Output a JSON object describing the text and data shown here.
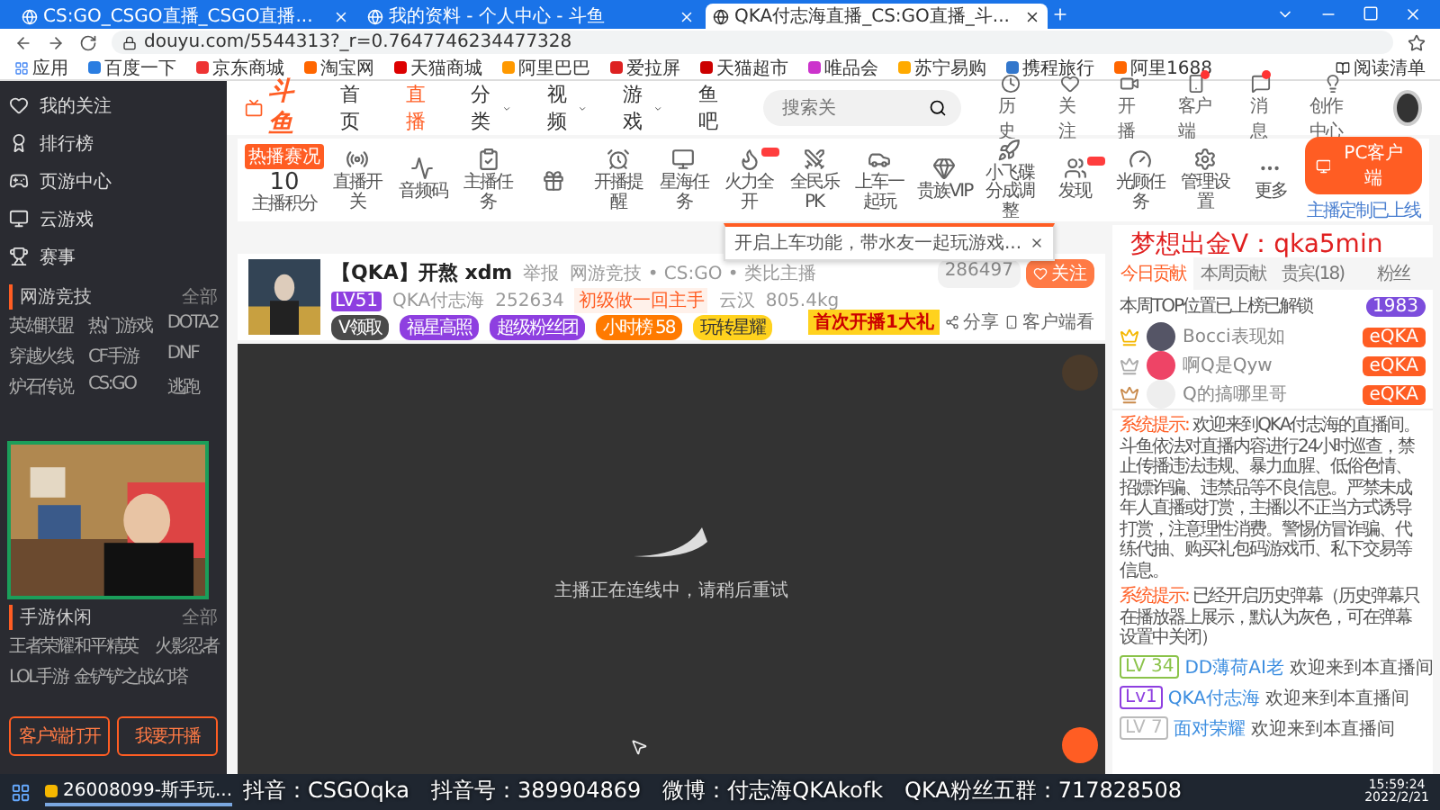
{
  "browser": {
    "tabs": [
      {
        "title": "CS:GO_CSGO直播_CSGO直播...",
        "selected": false
      },
      {
        "title": "我的资料 - 个人中心 - 斗鱼",
        "selected": false
      },
      {
        "title": "QKA付志海直播_CS:GO直播_斗...",
        "selected": true
      }
    ],
    "url": "douyu.com/5544313?_r=0.7647746234477328",
    "bookmarks": [
      "应用",
      "百度一下",
      "京东商城",
      "淘宝网",
      "天猫商城",
      "阿里巴巴",
      "爱拉屏",
      "天猫超市",
      "唯品会",
      "苏宁易购",
      "携程旅行",
      "阿里1688"
    ],
    "reading_list": "阅读清单"
  },
  "sidebar": {
    "items": [
      "我的关注",
      "排行榜",
      "页游中心",
      "云游戏",
      "赛事"
    ],
    "sections": [
      {
        "title": "网游竞技",
        "more": "全部",
        "games": [
          "英雄联盟",
          "热门游戏",
          "DOTA2",
          "穿越火线",
          "CF手游",
          "DNF",
          "炉石传说",
          "CS:GO",
          "逃跑"
        ]
      },
      {
        "title": "手游休闲",
        "more": "全部",
        "games": [
          "王者荣耀",
          "和平精英",
          "火影忍者",
          "LOL手游",
          "金铲铲之战",
          "幻塔"
        ]
      }
    ],
    "buttons": [
      "客户端打开",
      "我要开播"
    ]
  },
  "header": {
    "logo": "斗鱼",
    "nav": [
      {
        "label": "首页",
        "selected": false,
        "dropdown": false
      },
      {
        "label": "直播",
        "selected": true,
        "dropdown": false
      },
      {
        "label": "分类",
        "selected": false,
        "dropdown": true
      },
      {
        "label": "视频",
        "selected": false,
        "dropdown": true
      },
      {
        "label": "游戏",
        "selected": false,
        "dropdown": true
      },
      {
        "label": "鱼吧",
        "selected": false,
        "dropdown": false
      }
    ],
    "search": {
      "placeholder": "搜索关"
    },
    "icons": [
      {
        "label": "历史",
        "badge": false
      },
      {
        "label": "关注",
        "badge": false
      },
      {
        "label": "开播",
        "badge": false
      },
      {
        "label": "客户端",
        "badge": true
      },
      {
        "label": "消息",
        "badge": true
      },
      {
        "label": "创作中心",
        "badge": false
      }
    ]
  },
  "toolbar": {
    "tag": "热播赛况",
    "score": "10",
    "score_label": "主播积分",
    "tools": [
      {
        "label": "直播开关",
        "new": false
      },
      {
        "label": "音频码",
        "new": false
      },
      {
        "label": "主播任务",
        "new": false
      },
      {
        "new": false
      },
      {
        "label": "开播提醒",
        "new": false
      },
      {
        "label": "星海任务",
        "new": false
      },
      {
        "label": "火力全开",
        "new": true
      },
      {
        "label": "全民乐PK",
        "new": false
      },
      {
        "label": "上车一起玩",
        "new": false
      },
      {
        "label": "贵族VIP",
        "new": false
      },
      {
        "label": "小飞碟分成调整",
        "new": false
      },
      {
        "label": "发现",
        "new": true
      },
      {
        "label": "光顾任务",
        "new": false
      },
      {
        "label": "管理设置",
        "new": false
      },
      {
        "label": "更多",
        "new": false
      }
    ],
    "client_button": "PC客户端",
    "client_note": "主播定制已上线",
    "tooltip": "开启上车功能，带水友一起玩游戏..."
  },
  "stream": {
    "title": "【QKA】开熬 xdm",
    "report": "举报",
    "category": "网游竞技 • CS:GO • 类比主播",
    "level": "LV51",
    "anchor": "QKA付志海",
    "heat": "252634",
    "promo": "初级做一回主手",
    "location": "云汉",
    "weight": "805.4kg",
    "badges": [
      {
        "label": "V领取",
        "color": "#4a4a4a"
      },
      {
        "label": "福星高照",
        "color": "#8e3fe0"
      },
      {
        "label": "超级粉丝团",
        "color": "#8e3fe0"
      },
      {
        "label": "小时榜 58",
        "color": "#ff7a00"
      },
      {
        "label": "玩转星耀",
        "color": "#ffd21e"
      }
    ],
    "followers": "286497",
    "follow": "关注",
    "gift": "首次开播1大礼",
    "share": "分享",
    "client": "客户端看",
    "status": "主播正在连线中，请稍后重试"
  },
  "chat": {
    "overlay": "梦想出金V：qka5min",
    "tabs": [
      {
        "label": "今日贡献",
        "selected": true
      },
      {
        "label": "本周贡献",
        "selected": false
      },
      {
        "label": "贵宾(18)",
        "selected": false
      },
      {
        "label": "粉丝",
        "selected": false
      }
    ],
    "notice": "本周TOP位置已上榜已解锁",
    "count": "1983",
    "ranks": [
      {
        "name": "Bocci表现如",
        "badge": "eQKA"
      },
      {
        "name": "啊Q是Qyw",
        "badge": "eQKA"
      },
      {
        "name": "Q的搞哪里哥",
        "badge": "eQKA"
      }
    ],
    "messages": [
      {
        "kind": "system",
        "label": "系统提示:",
        "text": "欢迎来到QKA付志海的直播间。斗鱼依法对直播内容进行24小时巡查，禁止传播违法违规、暴力血腥、低俗色情、招嫖诈骗、违禁品等不良信息。严禁未成年人直播或打赏，主播以不正当方式诱导打赏，注意理性消费。警惕仿冒诈骗、代练代抽、购买礼包码游戏币、私下交易等信息。"
      },
      {
        "kind": "system",
        "label": "系统提示:",
        "text": "已经开启历史弹幕（历史弹幕只在播放器上展示，默认为灰色，可在弹幕设置中关闭）"
      },
      {
        "kind": "user",
        "level": "LV 34",
        "color": "#8bc34a",
        "user": "DD薄荷AI老",
        "text": "欢迎来到本直播间"
      },
      {
        "kind": "user",
        "level": "Lv1",
        "color": "#8e3fe0",
        "user": "QKA付志海",
        "text": "欢迎来到本直播间"
      },
      {
        "kind": "user",
        "level": "LV 7",
        "color": "#bbbbbb",
        "user": "面对荣耀",
        "text": "欢迎来到本直播间"
      }
    ]
  },
  "taskbar": {
    "app": "26008099-斯手玩...",
    "time": "15:59:24",
    "date": "2022/2/21"
  },
  "overlay_social": [
    "抖音：CSGOqka",
    "抖音号：389904869",
    "微博：付志海QKAkofk",
    "QKA粉丝五群：717828508"
  ]
}
